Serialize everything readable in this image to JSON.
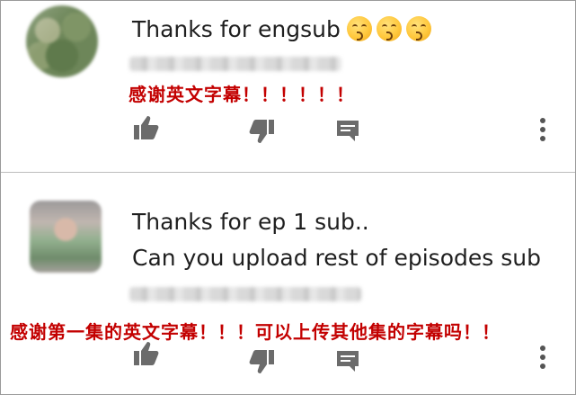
{
  "comments": [
    {
      "lines": [
        "Thanks for engsub"
      ],
      "emoji": [
        "kissing-face-emoji",
        "kissing-face-emoji",
        "kissing-face-emoji"
      ],
      "caption": "感谢英文字幕！！！！！！",
      "actions": [
        "thumbs-up-icon",
        "thumbs-down-icon",
        "reply-icon",
        "more-vertical-icon"
      ]
    },
    {
      "lines": [
        "Thanks for ep 1 sub..",
        "Can you upload rest of episodes sub"
      ],
      "caption": "感谢第一集的英文字幕！！！可以上传其他集的字幕吗！！",
      "actions": [
        "thumbs-up-icon",
        "thumbs-down-icon",
        "reply-icon",
        "more-vertical-icon"
      ]
    }
  ],
  "colors": {
    "caption": "#c30000",
    "text": "#1f1f1f",
    "icon": "#6b6b6b",
    "divider": "#bdbdbd"
  }
}
